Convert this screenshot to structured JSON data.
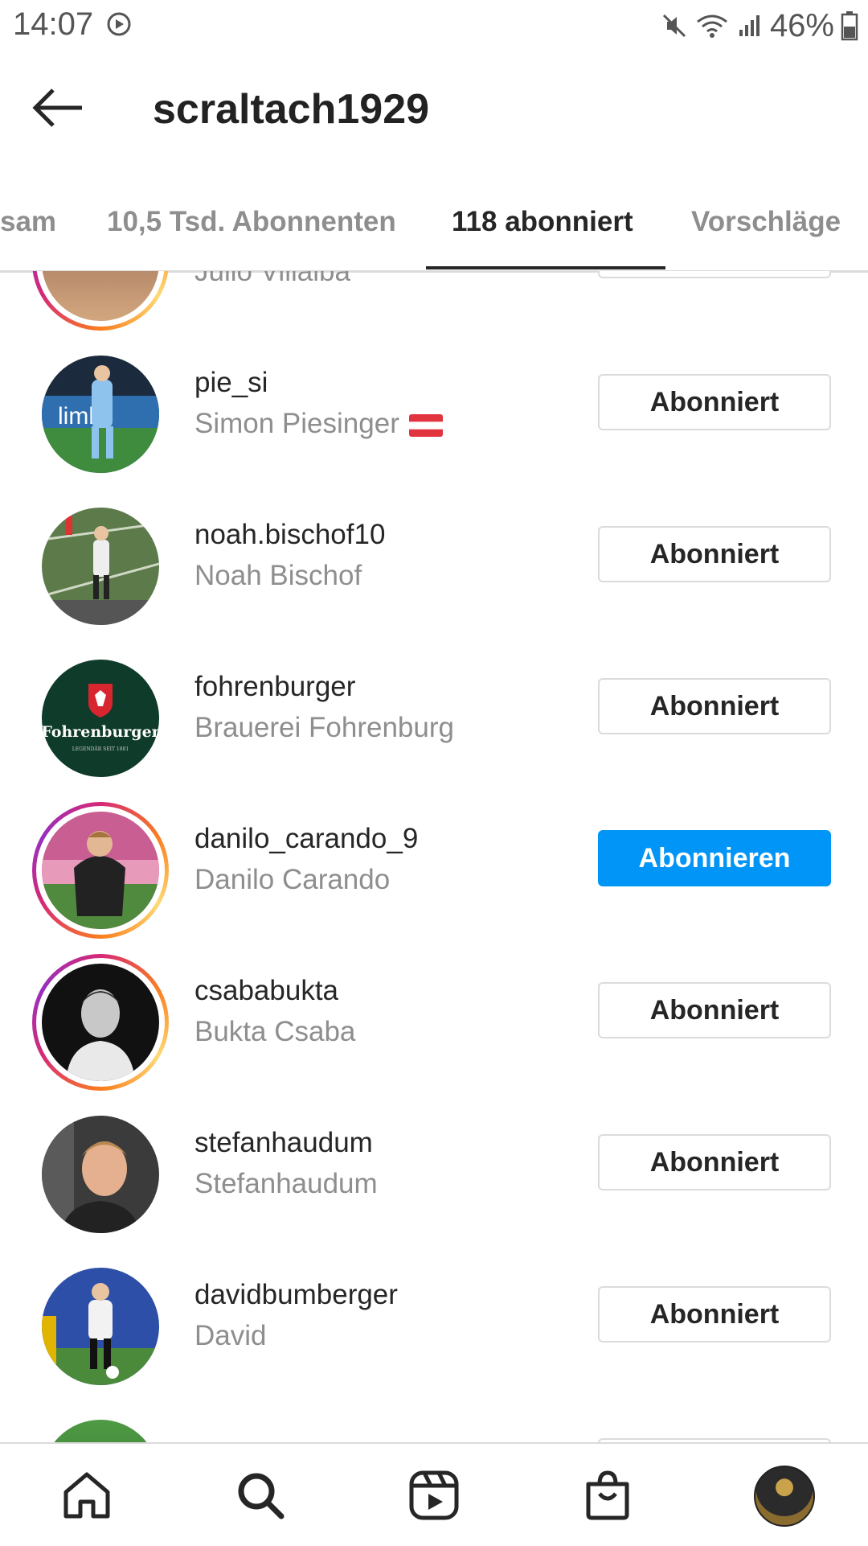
{
  "status_bar": {
    "time": "14:07",
    "battery": "46%"
  },
  "header": {
    "title": "scraltach1929"
  },
  "tabs": [
    {
      "label": "sam"
    },
    {
      "label": "10,5 Tsd. Abonnenten"
    },
    {
      "label": "118 abonniert"
    },
    {
      "label": "Vorschläge"
    }
  ],
  "list": {
    "partial_top": {
      "name": "Julio Villalba"
    },
    "items": [
      {
        "username": "pie_si",
        "name": "Simon Piesinger",
        "button": "Abonniert",
        "has_flag": true
      },
      {
        "username": "noah.bischof10",
        "name": "Noah Bischof",
        "button": "Abonniert"
      },
      {
        "username": "fohrenburger",
        "name": "Brauerei Fohrenburg",
        "button": "Abonniert"
      },
      {
        "username": "danilo_carando_9",
        "name": "Danilo Carando",
        "button": "Abonnieren"
      },
      {
        "username": "csababukta",
        "name": "Bukta Csaba",
        "button": "Abonniert"
      },
      {
        "username": "stefanhaudum",
        "name": "Stefanhaudum",
        "button": "Abonniert"
      },
      {
        "username": "davidbumberger",
        "name": "David",
        "button": "Abonniert"
      }
    ]
  },
  "logo": {
    "text": "Fohrenburger",
    "tagline": "LEGENDÄR SEIT 1881"
  },
  "bottom_nav": [
    "home-icon",
    "search-icon",
    "reels-icon",
    "shop-icon",
    "profile-avatar"
  ],
  "colors": {
    "primary": "#0095f6",
    "text": "#262626",
    "secondary": "#8e8e8e",
    "border": "#dbdbdb"
  }
}
